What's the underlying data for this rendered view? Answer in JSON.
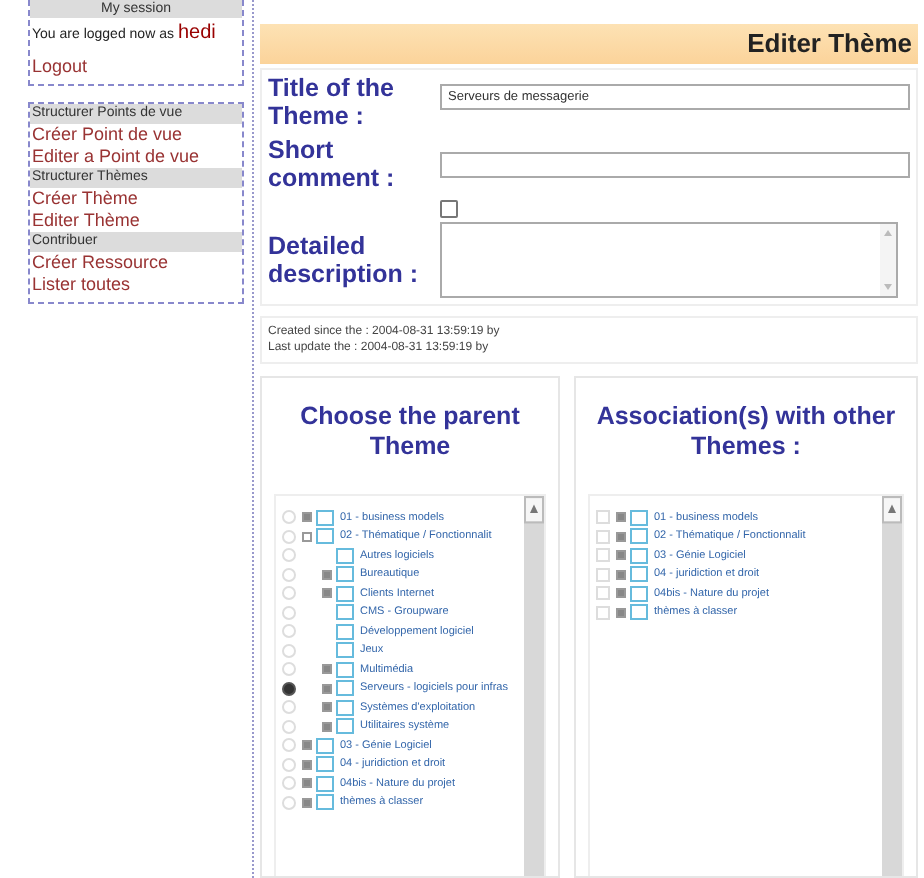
{
  "sidebar": {
    "session": {
      "header": "My session",
      "text": "You are logged now as",
      "user": "hedi",
      "logout": "Logout"
    },
    "menu": [
      {
        "kind": "header",
        "label": "Structurer Points de vue"
      },
      {
        "kind": "link",
        "label": "Créer Point de vue"
      },
      {
        "kind": "link",
        "label": "Editer a Point de vue"
      },
      {
        "kind": "header",
        "label": "Structurer Thèmes"
      },
      {
        "kind": "link",
        "label": "Créer Thème"
      },
      {
        "kind": "link",
        "label": "Editer Thème"
      },
      {
        "kind": "header",
        "label": "Contribuer"
      },
      {
        "kind": "link",
        "label": "Créer Ressource"
      },
      {
        "kind": "link",
        "label": "Lister toutes"
      }
    ]
  },
  "page_title": "Editer Thème",
  "fields": [
    {
      "kind": "text",
      "label": "Title of the Theme :",
      "value": "Serveurs de messagerie"
    },
    {
      "kind": "text",
      "label": "Short comment :"
    },
    {
      "kind": "checkbox",
      "checked": false
    },
    {
      "kind": "textarea",
      "label": "Detailed description :"
    }
  ],
  "meta": [
    "Created since the : 2004-08-31 13:59:19 by",
    "Last update the : 2004-08-31 13:59:19 by"
  ],
  "panels": [
    {
      "title": "Choose the parent Theme",
      "items": [
        {
          "label": "01 - business models",
          "expanded": false,
          "selected": false
        },
        {
          "label": "02 - Thématique / Fonctionnalit",
          "expanded": true,
          "selected": false,
          "children": [
            {
              "label": "Autres logiciels",
              "selected": false
            },
            {
              "label": "Bureautique",
              "expanded": false,
              "selected": false
            },
            {
              "label": "Clients Internet",
              "expanded": false,
              "selected": false
            },
            {
              "label": "CMS - Groupware",
              "selected": false
            },
            {
              "label": "Développement logiciel",
              "selected": false
            },
            {
              "label": "Jeux",
              "selected": false
            },
            {
              "label": "Multimédia",
              "expanded": false,
              "selected": false
            },
            {
              "label": "Serveurs - logiciels pour infras",
              "expanded": false,
              "selected": true
            },
            {
              "label": "Systèmes d'exploitation",
              "expanded": false,
              "selected": false
            },
            {
              "label": "Utilitaires système",
              "expanded": false,
              "selected": false
            }
          ]
        },
        {
          "label": "03 - Génie Logiciel",
          "expanded": false,
          "selected": false
        },
        {
          "label": "04 - juridiction et droit",
          "expanded": false,
          "selected": false
        },
        {
          "label": "04bis - Nature du projet",
          "expanded": false,
          "selected": false
        },
        {
          "label": "thèmes à classer",
          "expanded": false,
          "selected": false
        }
      ]
    },
    {
      "title": "Association(s) with other Themes :",
      "items": [
        {
          "label": "01 - business models",
          "expanded": false,
          "checked": false
        },
        {
          "label": "02 - Thématique / Fonctionnalit",
          "expanded": false,
          "checked": false
        },
        {
          "label": "03 - Génie Logiciel",
          "expanded": false,
          "checked": false
        },
        {
          "label": "04 - juridiction et droit",
          "expanded": false,
          "checked": false
        },
        {
          "label": "04bis - Nature du projet",
          "expanded": false,
          "checked": false
        },
        {
          "label": "thèmes à classer",
          "expanded": false,
          "checked": false
        }
      ]
    }
  ]
}
